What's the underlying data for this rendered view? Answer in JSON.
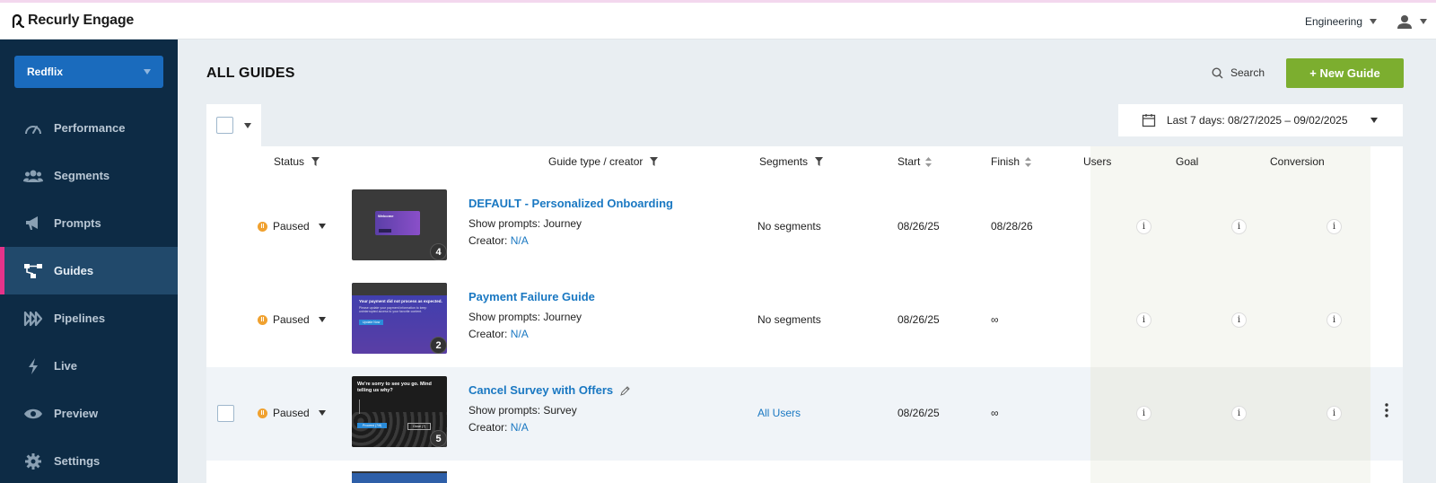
{
  "app": {
    "brand": "Recurly Engage"
  },
  "topbar": {
    "org": "Engineering",
    "user_icon": "user-icon"
  },
  "sidebar": {
    "app_selector": "Redflix",
    "items": [
      {
        "label": "Performance",
        "icon": "gauge-icon"
      },
      {
        "label": "Segments",
        "icon": "users-icon"
      },
      {
        "label": "Prompts",
        "icon": "megaphone-icon"
      },
      {
        "label": "Guides",
        "icon": "flow-icon",
        "active": true
      },
      {
        "label": "Pipelines",
        "icon": "pipelines-icon"
      },
      {
        "label": "Live",
        "icon": "bolt-icon"
      },
      {
        "label": "Preview",
        "icon": "eye-icon"
      },
      {
        "label": "Settings",
        "icon": "gear-icon"
      }
    ]
  },
  "main": {
    "title": "ALL GUIDES",
    "search_label": "Search",
    "new_button": "+ New Guide",
    "date_range": "Last 7 days: 08/27/2025 – 09/02/2025"
  },
  "table": {
    "headers": {
      "status": "Status",
      "type": "Guide type / creator",
      "segments": "Segments",
      "start": "Start",
      "finish": "Finish",
      "users": "Users",
      "goal": "Goal",
      "conversion": "Conversion"
    },
    "rows": [
      {
        "status": "Paused",
        "status_glyph": "II",
        "title": "DEFAULT - Personalized Onboarding",
        "show_prompts": "Show prompts: Journey",
        "creator_label": "Creator:",
        "creator": "N/A",
        "segments": "No segments",
        "start": "08/26/25",
        "finish": "08/28/26",
        "count": "4",
        "thumb_title": "Welcome",
        "info": "i"
      },
      {
        "status": "Paused",
        "status_glyph": "II",
        "title": "Payment Failure Guide",
        "show_prompts": "Show prompts: Journey",
        "creator_label": "Creator:",
        "creator": "N/A",
        "segments": "No segments",
        "start": "08/26/25",
        "finish": "∞",
        "count": "2",
        "thumb_title": "Your payment did not process as expected.",
        "thumb_body": "Please update your payment information to keep uninterrupted access to your favorite content.",
        "thumb_button": "Update Now",
        "info": "i"
      },
      {
        "status": "Paused",
        "status_glyph": "II",
        "title": "Cancel Survey with Offers",
        "show_prompts": "Show prompts: Survey",
        "creator_label": "Creator:",
        "creator": "N/A",
        "segments": "All Users",
        "start": "08/26/25",
        "finish": "∞",
        "count": "5",
        "thumb_title": "We're sorry to see you go. Mind telling us why?",
        "thumb_button": "Proceed (7/8)",
        "thumb_button2": "Close (7)",
        "info": "i"
      }
    ]
  },
  "colors": {
    "sidebar": "#0d2b45",
    "accent": "#1a78c2",
    "new_button": "#7cae2f",
    "active_marker": "#e5338a",
    "paused": "#f0a12f"
  }
}
